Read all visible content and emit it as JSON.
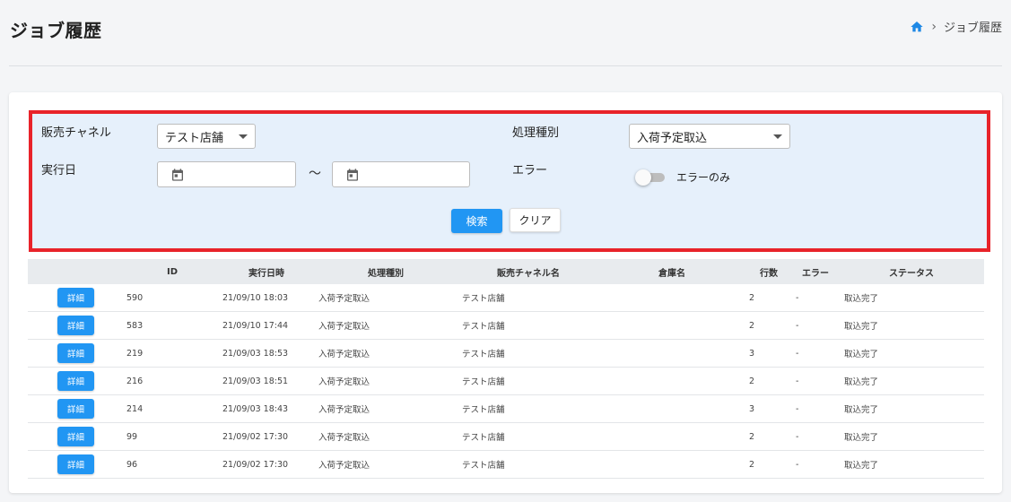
{
  "header": {
    "title": "ジョブ履歴",
    "breadcrumb_current": "ジョブ履歴"
  },
  "search": {
    "channel_label": "販売チャネル",
    "channel_value": "テスト店舗",
    "process_label": "処理種別",
    "process_value": "入荷予定取込",
    "date_label": "実行日",
    "date_from": "",
    "date_to": "",
    "date_separator": "〜",
    "error_label": "エラー",
    "error_toggle_label": "エラーのみ",
    "error_only": false,
    "search_button": "検索",
    "clear_button": "クリア"
  },
  "table": {
    "headers": [
      "ID",
      "実行日時",
      "処理種別",
      "販売チャネル名",
      "倉庫名",
      "行数",
      "エラー",
      "ステータス"
    ],
    "detail_button": "詳細",
    "rows": [
      {
        "id": "590",
        "datetime": "21/09/10 18:03",
        "process": "入荷予定取込",
        "channel": "テスト店舗",
        "warehouse": "",
        "lines": "2",
        "error": "-",
        "status": "取込完了"
      },
      {
        "id": "583",
        "datetime": "21/09/10 17:44",
        "process": "入荷予定取込",
        "channel": "テスト店舗",
        "warehouse": "",
        "lines": "2",
        "error": "-",
        "status": "取込完了"
      },
      {
        "id": "219",
        "datetime": "21/09/03 18:53",
        "process": "入荷予定取込",
        "channel": "テスト店舗",
        "warehouse": "",
        "lines": "3",
        "error": "-",
        "status": "取込完了"
      },
      {
        "id": "216",
        "datetime": "21/09/03 18:51",
        "process": "入荷予定取込",
        "channel": "テスト店舗",
        "warehouse": "",
        "lines": "2",
        "error": "-",
        "status": "取込完了"
      },
      {
        "id": "214",
        "datetime": "21/09/03 18:43",
        "process": "入荷予定取込",
        "channel": "テスト店舗",
        "warehouse": "",
        "lines": "3",
        "error": "-",
        "status": "取込完了"
      },
      {
        "id": "99",
        "datetime": "21/09/02 17:30",
        "process": "入荷予定取込",
        "channel": "テスト店舗",
        "warehouse": "",
        "lines": "2",
        "error": "-",
        "status": "取込完了"
      },
      {
        "id": "96",
        "datetime": "21/09/02 17:30",
        "process": "入荷予定取込",
        "channel": "テスト店舗",
        "warehouse": "",
        "lines": "2",
        "error": "-",
        "status": "取込完了"
      }
    ]
  },
  "colors": {
    "accent": "#2196f3",
    "highlight_border": "#e8232a",
    "panel_bg": "#e6f0fb"
  },
  "icons": [
    "home-icon",
    "chevron-right-icon",
    "calendar-icon",
    "caret-down-icon"
  ]
}
